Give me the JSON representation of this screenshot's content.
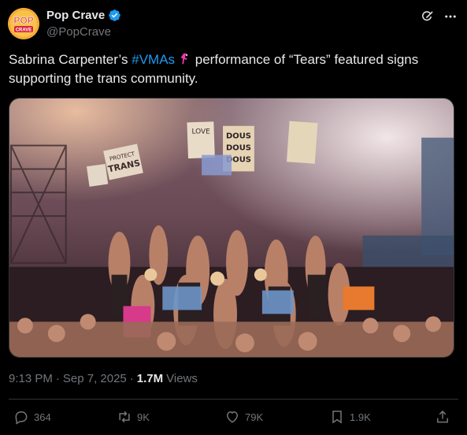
{
  "author": {
    "display_name": "Pop Crave",
    "handle": "@PopCrave",
    "avatar_text_top": "POP",
    "avatar_text_bottom": "CRAVE",
    "verified": true
  },
  "tweet": {
    "text_before": "Sabrina Carpenter’s ",
    "hashtag": "#VMAs",
    "text_after": " performance of “Tears” featured signs supporting the trans community.",
    "emoji": "vma-moonperson"
  },
  "media": {
    "alt": "",
    "signs": [
      "LOVE",
      "DOUS",
      "DOUS",
      "DOUS",
      "PROTECT",
      "TRANS"
    ]
  },
  "meta": {
    "time": "9:13 PM",
    "separator": "·",
    "date": "Sep 7, 2025",
    "views_count": "1.7M",
    "views_label": "Views"
  },
  "actions": {
    "replies": "364",
    "reposts": "9K",
    "likes": "79K",
    "bookmarks": "1.9K"
  },
  "colors": {
    "background": "#000000",
    "text": "#e7e9ea",
    "muted": "#71767b",
    "accent": "#1d9bf0",
    "border": "#2f3336"
  }
}
